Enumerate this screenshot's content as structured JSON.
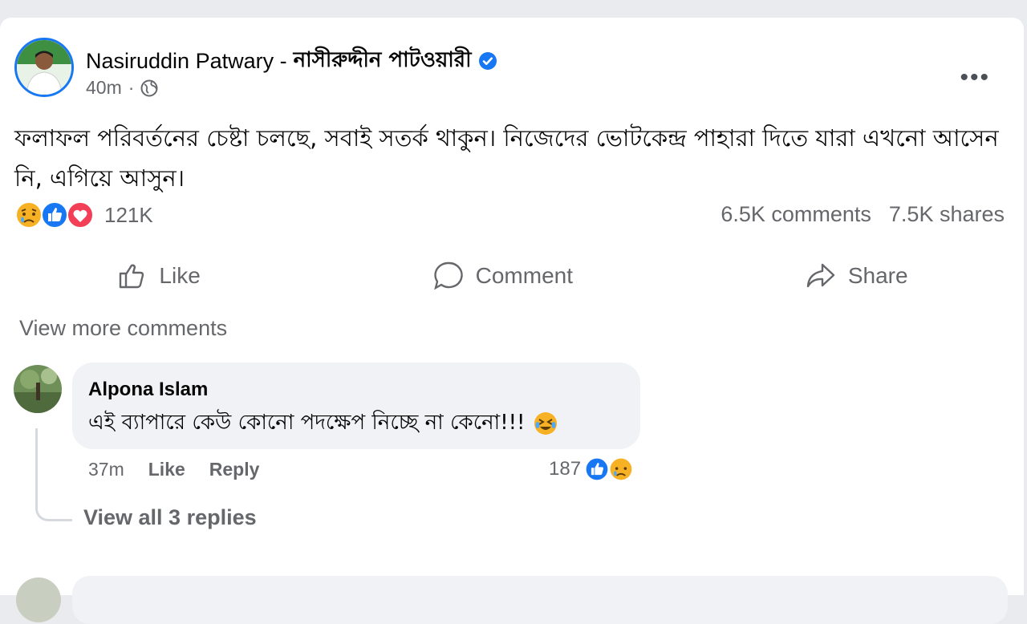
{
  "post": {
    "author_en": "Nasiruddin Patwary - ",
    "author_bn": "নাসীরুদ্দীন পাটওয়ারী",
    "time": "40m",
    "separator": "·",
    "more_label": "•••",
    "text": "ফলাফল পরিবর্তনের চেষ্টা চলছে, সবাই সতর্ক থাকুন। নিজেদের ভোটকেন্দ্র পাহারা দিতে যারা এখনো আসেন নি, এগিয়ে আসুন।",
    "reaction_count": "121K",
    "comments": "6.5K comments",
    "shares": "7.5K shares",
    "reaction_icons": [
      "sad-icon",
      "like-icon",
      "love-icon"
    ]
  },
  "actions": {
    "like": "Like",
    "comment": "Comment",
    "share": "Share"
  },
  "view_more_comments": "View more comments",
  "comment": {
    "author": "Alpona Islam",
    "text": "এই ব্যাপারে কেউ কোনো পদক্ষেপ নিচ্ছে না কেনো!!!",
    "time": "37m",
    "like": "Like",
    "reply": "Reply",
    "reaction_count": "187",
    "reaction_icons": [
      "like-icon",
      "sad-icon"
    ],
    "view_replies": "View all 3 replies"
  },
  "colors": {
    "brand_blue": "#1877f2",
    "secondary_text": "#65676b",
    "love_red": "#f33e58",
    "sad_yellow": "#f7b125"
  }
}
